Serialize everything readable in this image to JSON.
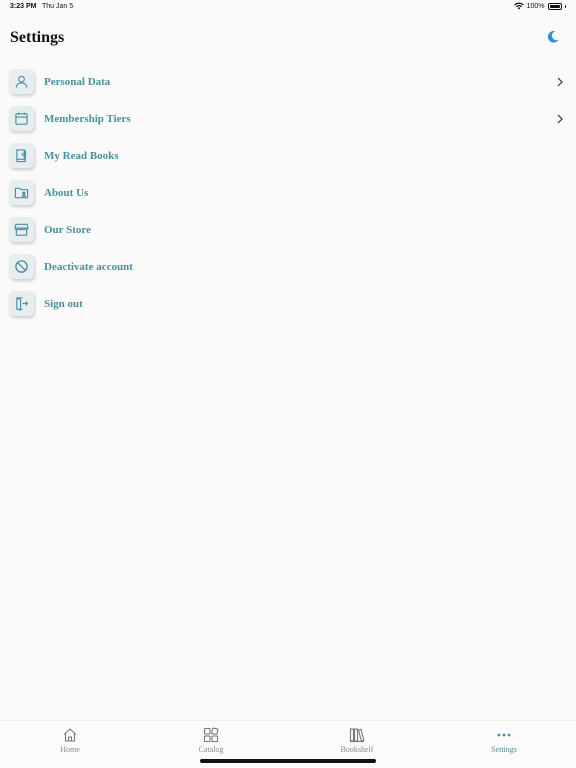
{
  "status_bar": {
    "time": "3:23 PM",
    "date": "Thu Jan 5",
    "battery": "100%"
  },
  "header": {
    "title": "Settings"
  },
  "colors": {
    "accent": "#4a8f9f",
    "toggle": "#2d8fe0",
    "icon_bg": "#e8edf0"
  },
  "menu": {
    "items": [
      {
        "label": "Personal Data",
        "icon": "user-icon",
        "has_chevron": true
      },
      {
        "label": "Membership Tiers",
        "icon": "calendar-icon",
        "has_chevron": true
      },
      {
        "label": "My Read Books",
        "icon": "book-icon",
        "has_chevron": false
      },
      {
        "label": "About Us",
        "icon": "folder-users-icon",
        "has_chevron": false
      },
      {
        "label": "Our Store",
        "icon": "store-icon",
        "has_chevron": false
      },
      {
        "label": "Deactivate account",
        "icon": "ban-icon",
        "has_chevron": false
      },
      {
        "label": "Sign out",
        "icon": "sign-out-icon",
        "has_chevron": false
      }
    ]
  },
  "tabs": [
    {
      "label": "Home",
      "icon": "home-icon"
    },
    {
      "label": "Catalog",
      "icon": "grid-icon"
    },
    {
      "label": "Bookshelf",
      "icon": "bookshelf-icon"
    },
    {
      "label": "Settings",
      "icon": "more-dots-icon",
      "active": true
    }
  ]
}
